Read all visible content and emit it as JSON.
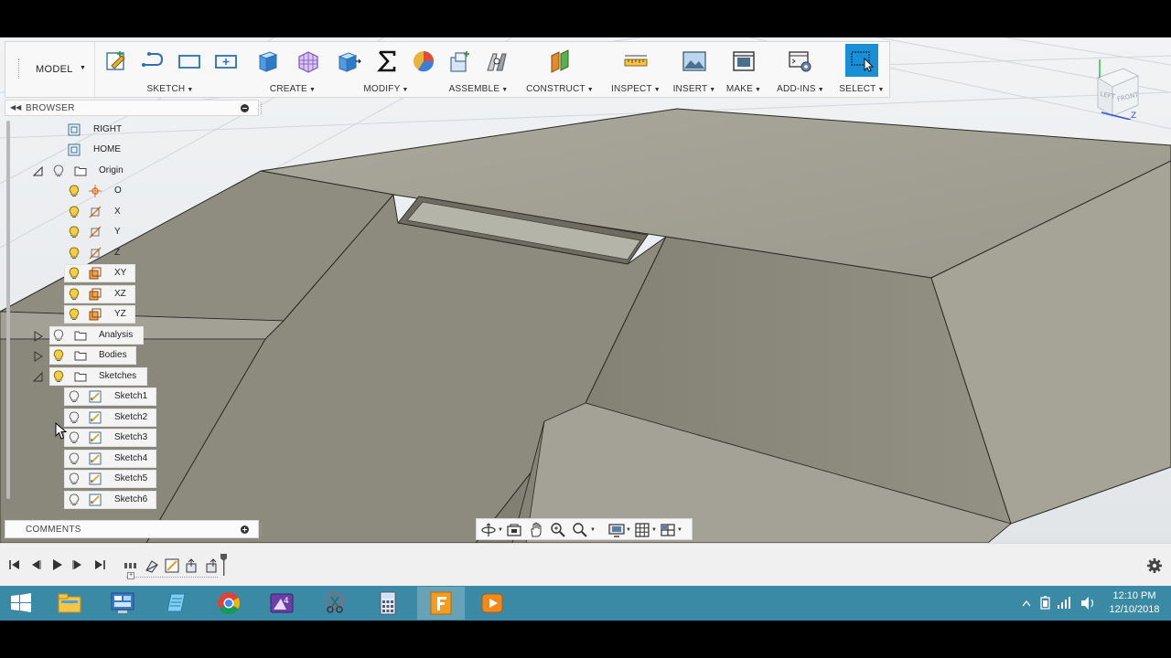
{
  "toolbar": {
    "workspace": "MODEL",
    "groups": [
      {
        "id": "sketch",
        "label": "SKETCH"
      },
      {
        "id": "create",
        "label": "CREATE"
      },
      {
        "id": "modify",
        "label": "MODIFY"
      },
      {
        "id": "assemble",
        "label": "ASSEMBLE"
      },
      {
        "id": "construct",
        "label": "CONSTRUCT"
      },
      {
        "id": "inspect",
        "label": "INSPECT"
      },
      {
        "id": "insert",
        "label": "INSERT"
      },
      {
        "id": "make",
        "label": "MAKE"
      },
      {
        "id": "addins",
        "label": "ADD-INS"
      },
      {
        "id": "select",
        "label": "SELECT"
      }
    ]
  },
  "browser": {
    "title": "BROWSER",
    "tree": [
      {
        "label": "RIGHT",
        "type": "view"
      },
      {
        "label": "HOME",
        "type": "view"
      },
      {
        "label": "Origin",
        "type": "folder",
        "expanded": true
      },
      {
        "label": "O",
        "type": "origin-point"
      },
      {
        "label": "X",
        "type": "axis"
      },
      {
        "label": "Y",
        "type": "axis"
      },
      {
        "label": "Z",
        "type": "axis"
      },
      {
        "label": "XY",
        "type": "plane"
      },
      {
        "label": "XZ",
        "type": "plane"
      },
      {
        "label": "YZ",
        "type": "plane"
      },
      {
        "label": "Analysis",
        "type": "folder",
        "expanded": false
      },
      {
        "label": "Bodies",
        "type": "folder",
        "expanded": false
      },
      {
        "label": "Sketches",
        "type": "folder",
        "expanded": true
      },
      {
        "label": "Sketch1",
        "type": "sketch"
      },
      {
        "label": "Sketch2",
        "type": "sketch"
      },
      {
        "label": "Sketch3",
        "type": "sketch"
      },
      {
        "label": "Sketch4",
        "type": "sketch"
      },
      {
        "label": "Sketch5",
        "type": "sketch"
      },
      {
        "label": "Sketch6",
        "type": "sketch"
      }
    ]
  },
  "comments": {
    "title": "COMMENTS"
  },
  "viewcube": {
    "faces": [
      "LEFT",
      "FRONT"
    ],
    "axis": "Z"
  },
  "timeline": {
    "feature_icons": [
      "sketch-feature-icon",
      "extrude-feature-icon",
      "sketch-feature-icon",
      "extrude-feature-icon",
      "extrude-feature-icon"
    ]
  },
  "taskbar": {
    "apps": [
      "file-explorer-icon",
      "control-panel-icon",
      "notepad-icon",
      "chrome-icon",
      "media-app-icon",
      "snipping-tool-icon",
      "calculator-icon",
      "fusion360-icon",
      "video-player-icon"
    ],
    "time": "12:10 PM",
    "date": "12/10/2018"
  },
  "colors": {
    "accent": "#1b8fd6",
    "taskbar": "#3b8aa5",
    "model_top": "#9e9d90",
    "model_side": "#8b897b"
  }
}
